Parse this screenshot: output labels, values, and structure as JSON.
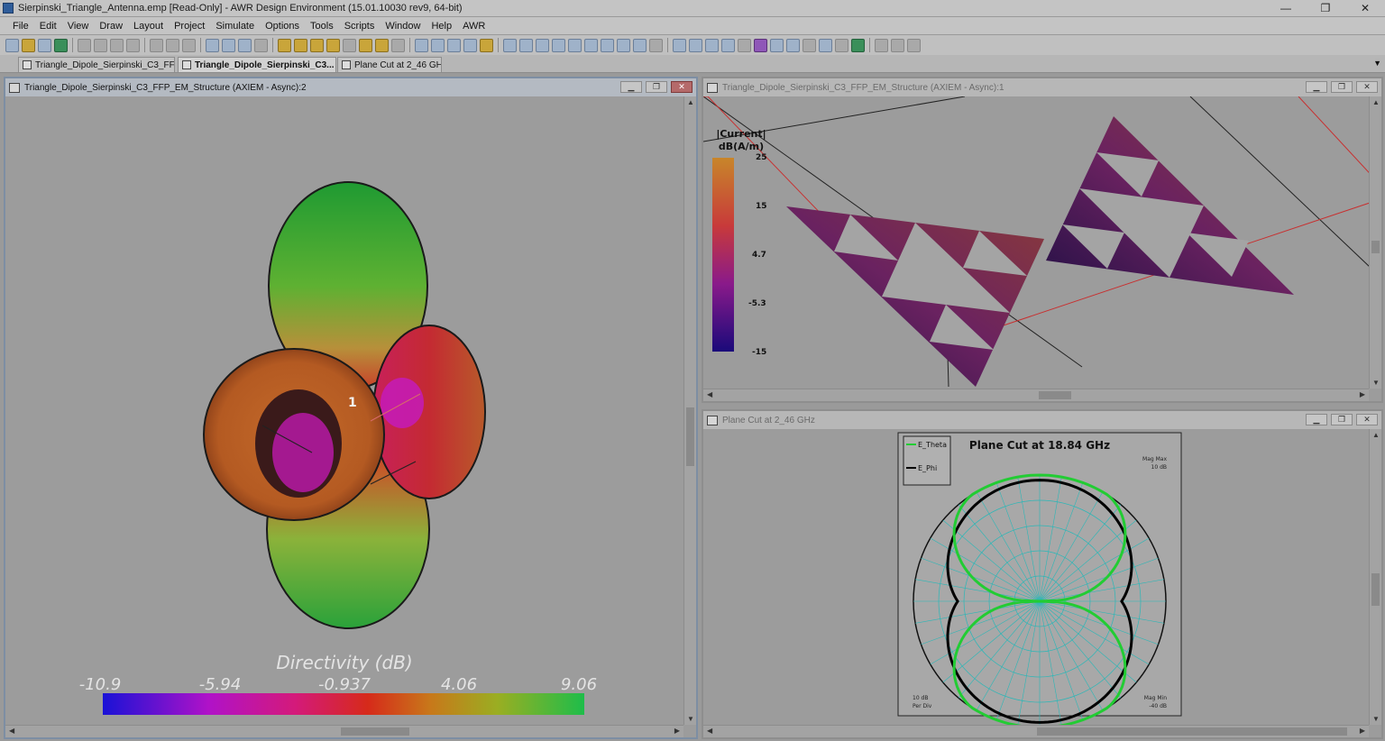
{
  "app": {
    "title": "Sierpinski_Triangle_Antenna.emp [Read-Only] - AWR Design Environment (15.01.10030 rev9, 64-bit)",
    "window_controls": {
      "minimize": "—",
      "restore": "❐",
      "close": "✕"
    }
  },
  "menu": [
    "File",
    "Edit",
    "View",
    "Draw",
    "Layout",
    "Project",
    "Simulate",
    "Options",
    "Tools",
    "Scripts",
    "Window",
    "Help",
    "AWR"
  ],
  "tabs": [
    {
      "label": "Triangle_Dipole_Sierpinski_C3_FFP...",
      "close": ""
    },
    {
      "label": "Triangle_Dipole_Sierpinski_C3...",
      "close": "✕"
    },
    {
      "label": "Plane Cut at 2_46 GHz",
      "close": ""
    }
  ],
  "windows": {
    "left": {
      "title": "Triangle_Dipole_Sierpinski_C3_FFP_EM_Structure (AXIEM - Async):2",
      "marker": "1",
      "legend": {
        "title": "Directivity (dB)",
        "ticks": [
          "-10.9",
          "-5.94",
          "-0.937",
          "4.06",
          "9.06"
        ]
      }
    },
    "top_right": {
      "title": "Triangle_Dipole_Sierpinski_C3_FFP_EM_Structure (AXIEM - Async):1",
      "legend": {
        "title_line1": "|Current|",
        "title_line2": "dB(A/m)",
        "ticks": [
          "25",
          "15",
          "4.7",
          "-5.3",
          "-15"
        ]
      }
    },
    "bottom_right": {
      "title": "Plane Cut at 2_46 GHz",
      "chart_title": "Plane Cut at 18.84 GHz",
      "legend": [
        "E_Theta",
        "E_Phi"
      ],
      "mag_max": "Mag Max",
      "mag_max_val": "10 dB",
      "mag_min": "Mag Min",
      "mag_min_val": "-40 dB",
      "per_div": "10 dB",
      "per_div_label": "Per Div"
    }
  },
  "colors": {
    "e_theta": "#22cc33",
    "e_phi": "#000000",
    "grid": "#2bb7b7"
  },
  "chart_data": {
    "type": "polar",
    "title": "Plane Cut at 18.84 GHz",
    "r_range_db": [
      -40,
      10
    ],
    "r_per_div_db": 10,
    "series": [
      {
        "name": "E_Theta",
        "color": "#22cc33",
        "shape": "four-lobe",
        "max_db": 10,
        "min_db": -40
      },
      {
        "name": "E_Phi",
        "color": "#000000",
        "shape": "oval",
        "max_db": 8,
        "min_db": -30
      }
    ]
  }
}
